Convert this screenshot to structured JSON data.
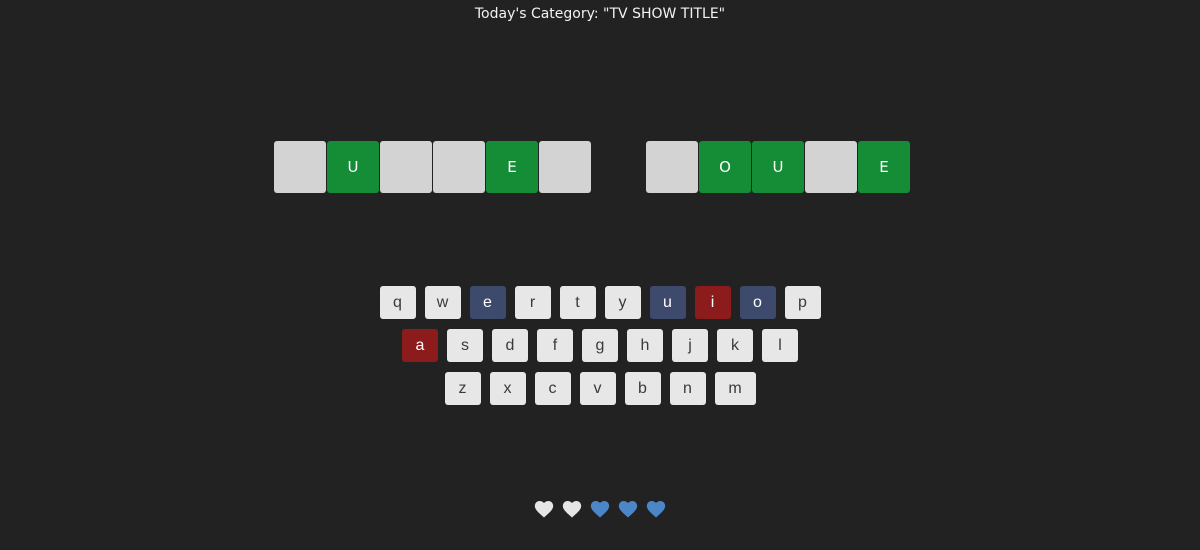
{
  "header": {
    "category_text": "Today's Category: \"TV SHOW TITLE\""
  },
  "board": {
    "words": [
      {
        "tiles": [
          {
            "letter": "",
            "state": "empty"
          },
          {
            "letter": "U",
            "state": "correct"
          },
          {
            "letter": "",
            "state": "empty"
          },
          {
            "letter": "",
            "state": "empty"
          },
          {
            "letter": "E",
            "state": "correct"
          },
          {
            "letter": "",
            "state": "empty"
          }
        ]
      },
      {
        "tiles": [
          {
            "letter": "",
            "state": "empty"
          },
          {
            "letter": "O",
            "state": "correct"
          },
          {
            "letter": "U",
            "state": "correct"
          },
          {
            "letter": "",
            "state": "empty"
          },
          {
            "letter": "E",
            "state": "correct"
          }
        ]
      }
    ]
  },
  "keyboard": {
    "rows": [
      [
        {
          "key": "q",
          "state": "unused"
        },
        {
          "key": "w",
          "state": "unused"
        },
        {
          "key": "e",
          "state": "present"
        },
        {
          "key": "r",
          "state": "unused"
        },
        {
          "key": "t",
          "state": "unused"
        },
        {
          "key": "y",
          "state": "unused"
        },
        {
          "key": "u",
          "state": "present"
        },
        {
          "key": "i",
          "state": "absent"
        },
        {
          "key": "o",
          "state": "present"
        },
        {
          "key": "p",
          "state": "unused"
        }
      ],
      [
        {
          "key": "a",
          "state": "absent"
        },
        {
          "key": "s",
          "state": "unused"
        },
        {
          "key": "d",
          "state": "unused"
        },
        {
          "key": "f",
          "state": "unused"
        },
        {
          "key": "g",
          "state": "unused"
        },
        {
          "key": "h",
          "state": "unused"
        },
        {
          "key": "j",
          "state": "unused"
        },
        {
          "key": "k",
          "state": "unused"
        },
        {
          "key": "l",
          "state": "unused"
        }
      ],
      [
        {
          "key": "z",
          "state": "unused"
        },
        {
          "key": "x",
          "state": "unused"
        },
        {
          "key": "c",
          "state": "unused"
        },
        {
          "key": "v",
          "state": "unused"
        },
        {
          "key": "b",
          "state": "unused"
        },
        {
          "key": "n",
          "state": "unused"
        },
        {
          "key": "m",
          "state": "unused"
        }
      ]
    ]
  },
  "lives": {
    "total": 5,
    "used": 2,
    "icon": "heart-icon",
    "used_color": "#e6e6e6",
    "remaining_color": "#4a86c8"
  },
  "colors": {
    "background": "#222222",
    "correct_tile": "#158c36",
    "empty_tile": "#d3d3d3",
    "key_unused": "#e7e7e7",
    "key_present": "#3e4a6b",
    "key_absent": "#8c1c1c"
  }
}
